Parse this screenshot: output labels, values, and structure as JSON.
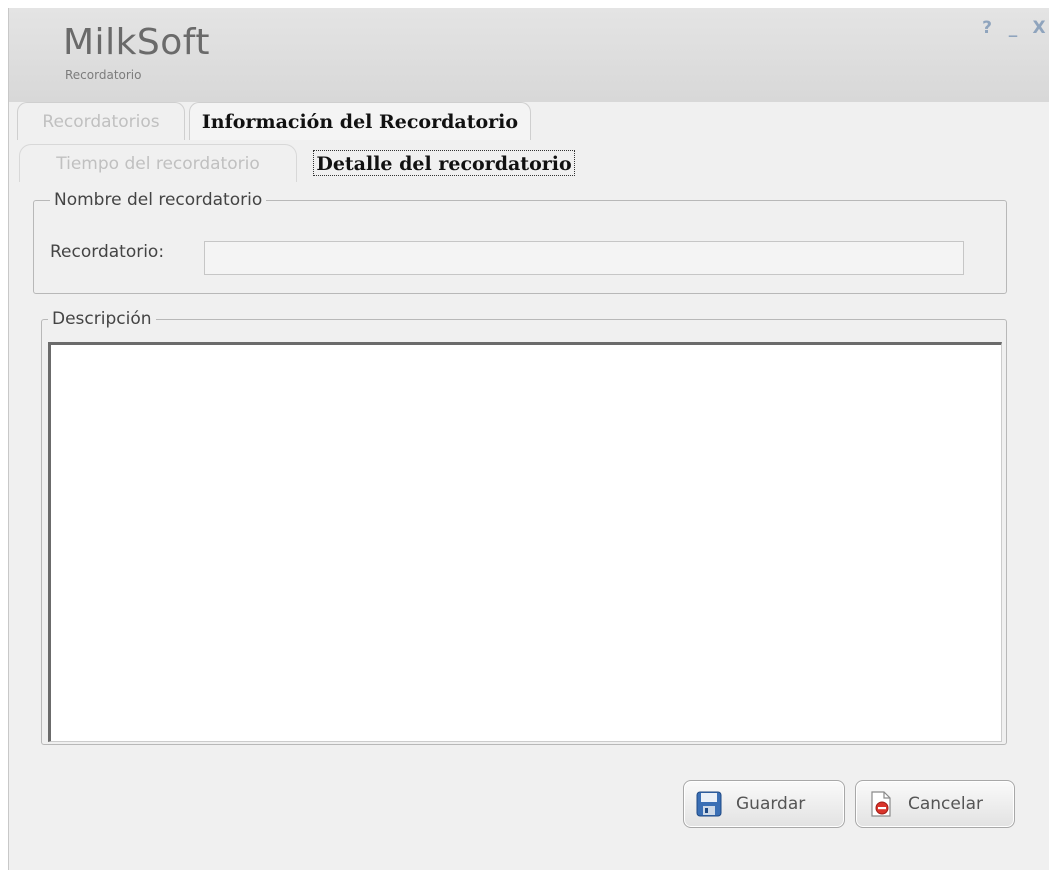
{
  "header": {
    "app_title": "MilkSoft",
    "subtitle": "Recordatorio"
  },
  "window_controls": {
    "help": "?",
    "minimize": "_",
    "close": "X"
  },
  "tabs_main": [
    {
      "label": "Recordatorios",
      "active": false
    },
    {
      "label": "Información del Recordatorio",
      "active": true
    }
  ],
  "tabs_sub": [
    {
      "label": "Tiempo del recordatorio",
      "active": false
    },
    {
      "label": "Detalle del recordatorio",
      "active": true
    }
  ],
  "name_group": {
    "legend": "Nombre del recordatorio",
    "field_label": "Recordatorio:",
    "field_value": ""
  },
  "description_group": {
    "legend": "Descripción",
    "value": ""
  },
  "buttons": {
    "save": "Guardar",
    "cancel": "Cancelar"
  },
  "icons": {
    "save": "floppy-disk-icon",
    "cancel": "cancel-document-icon"
  }
}
